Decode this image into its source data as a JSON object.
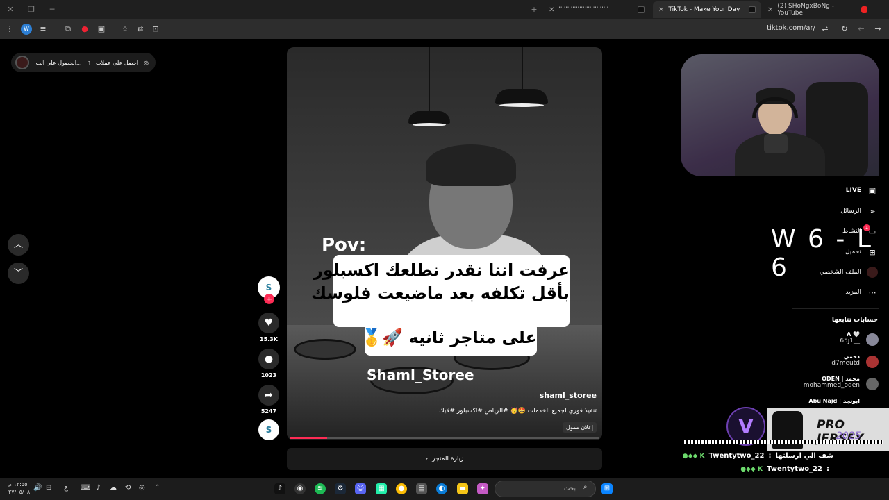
{
  "browser": {
    "tabs": [
      {
        "title": "ꞌꞌꞌꞌꞌꞌꞌꞌꞌꞌꞌꞌꞌꞌꞌꞌꞌꞌꞌꞌꞌꞌꞌꞌꞌꞌꞌꞌꞌ",
        "active": false
      },
      {
        "title": "TikTok - Make Your Day",
        "active": true
      },
      {
        "title": "(2) SHoNgxBoNg - YouTube",
        "active": false
      }
    ],
    "url": "tiktok.com/ar/"
  },
  "topbar": {
    "get_coins": "احصل على عملات",
    "get_app": "الحصول على الت..."
  },
  "video": {
    "pov": "Pov:",
    "caption_lines": [
      "عرفت اننا نقدر نطلعك اكسبلور",
      "بأقل تكلفه بعد ماضيعت فلوسك",
      "على متاجر ثانيه 🚀🥇"
    ],
    "watermark": "Shaml_Storee",
    "username": "shaml_storee",
    "description": "تنفيذ فوري لجميع الخدمات 🤩🥳 #الرياض #اكسبلور #لايك",
    "ad_label": "إعلان ممول",
    "progress": 0.12,
    "visit_store": "زيارة المتجر"
  },
  "actions": {
    "account_initial": "S",
    "likes": "15.3K",
    "comments": "1023",
    "shares": "5247"
  },
  "sidebar": {
    "items": [
      {
        "label": "LIVE",
        "icon": "live-icon"
      },
      {
        "label": "الرسائل",
        "icon": "messages-icon"
      },
      {
        "label": "النشاط",
        "icon": "activity-icon",
        "badge": "1"
      },
      {
        "label": "تحميل",
        "icon": "upload-icon"
      },
      {
        "label": "الملف الشخصي",
        "icon": "profile-icon"
      },
      {
        "label": "المزيد",
        "icon": "more-icon"
      }
    ],
    "following_title": "حسابات تتابعها",
    "following": [
      {
        "name": "A 🤍",
        "handle": "65j1__"
      },
      {
        "name": "دحمي",
        "handle": "d7meutd"
      },
      {
        "name": "ODEN | محمد",
        "handle": "mohammed_oden"
      },
      {
        "name": "Abu Najd | ابونجد",
        "handle": ""
      }
    ]
  },
  "overlay": {
    "score": "W 6 - L 6",
    "jersey_title": "PRO JERSEY",
    "jersey_year": "2025",
    "logo_letter": "V",
    "chat": [
      {
        "user": "Twentytwo_22",
        "message": "شف الي ارسلتها"
      },
      {
        "user": "Twentytwo_22",
        "message": ""
      }
    ]
  },
  "taskbar": {
    "search_placeholder": "بحث",
    "time": "١٢:٥٥ م",
    "date": "٢٧/٠٥/٠٨",
    "lang": "ع"
  }
}
